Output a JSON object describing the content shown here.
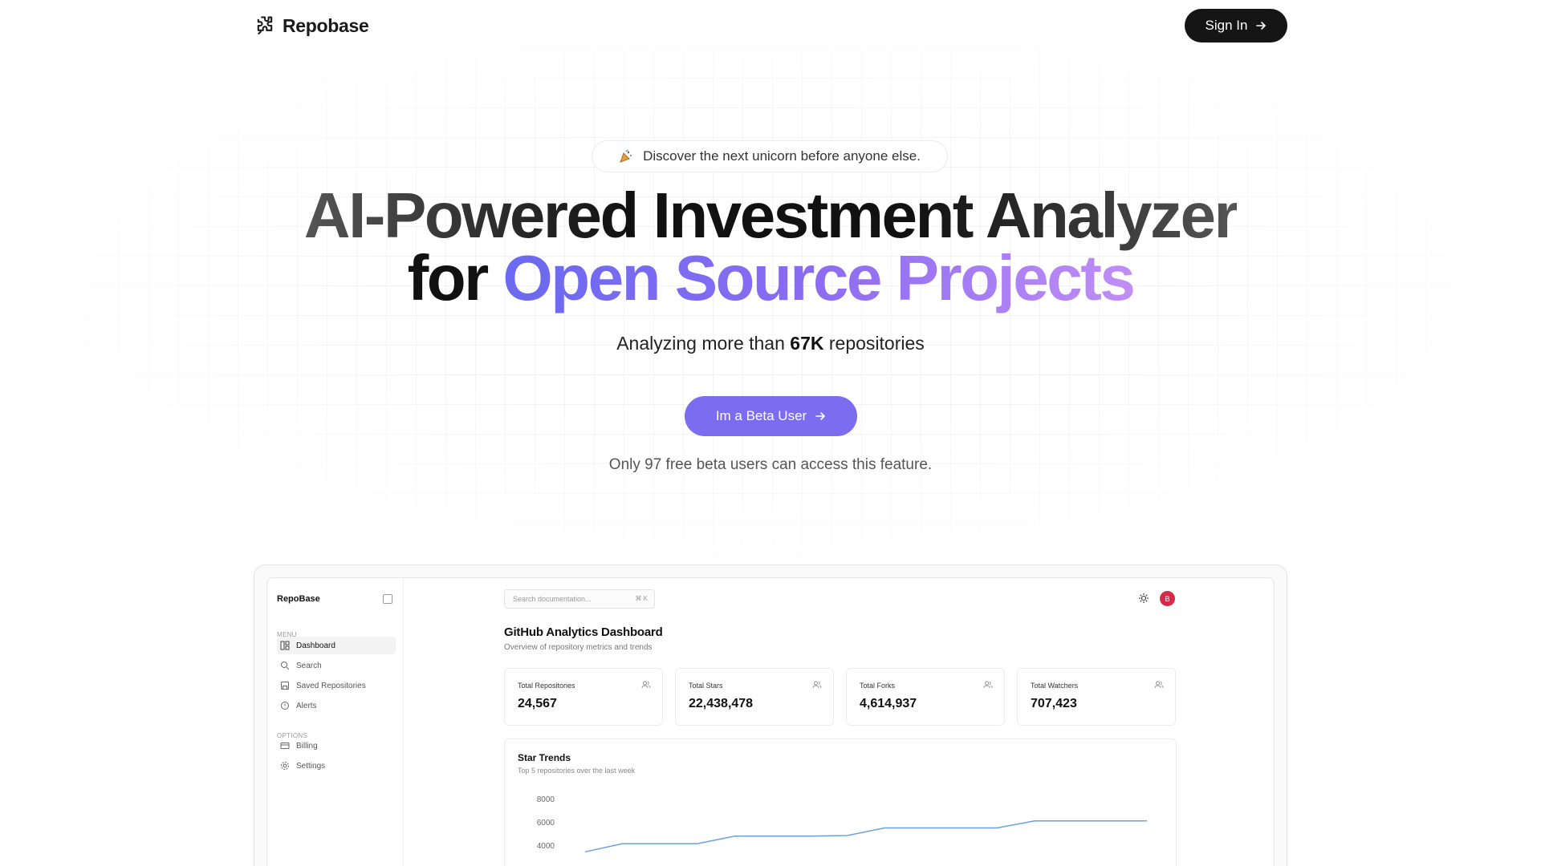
{
  "header": {
    "brand": "Repobase",
    "sign_in": "Sign In"
  },
  "hero": {
    "pill_text": "Discover the next unicorn before anyone else.",
    "headline_line1": "AI-Powered Investment Analyzer",
    "headline_for": "for",
    "headline_gradient": "Open Source Projects",
    "sub_prefix": "Analyzing more than",
    "sub_count": "67K",
    "sub_suffix": "repositories",
    "cta": "Im a Beta User",
    "note": "Only 97 free beta users can access this feature."
  },
  "dashboard": {
    "brand": "RepoBase",
    "menu_label": "MENU",
    "menu": [
      {
        "label": "Dashboard",
        "icon": "dashboard-icon"
      },
      {
        "label": "Search",
        "icon": "search-icon"
      },
      {
        "label": "Saved Repositories",
        "icon": "save-icon"
      },
      {
        "label": "Alerts",
        "icon": "alert-icon"
      }
    ],
    "options_label": "OPTIONS",
    "options": [
      {
        "label": "Billing",
        "icon": "card-icon"
      },
      {
        "label": "Settings",
        "icon": "gear-icon"
      }
    ],
    "search_placeholder": "Search documentation...",
    "search_kbd": "⌘ K",
    "avatar_initial": "B",
    "title": "GitHub Analytics Dashboard",
    "subtitle": "Overview of repository metrics and trends",
    "stats": [
      {
        "label": "Total Repositories",
        "value": "24,567"
      },
      {
        "label": "Total Stars",
        "value": "22,438,478"
      },
      {
        "label": "Total Forks",
        "value": "4,614,937"
      },
      {
        "label": "Total Watchers",
        "value": "707,423"
      }
    ],
    "chart_title": "Star Trends",
    "chart_subtitle": "Top 5 repositories over the last week"
  },
  "colors": {
    "accent": "#7c6cf0",
    "gradient_start": "#6a6af0",
    "gradient_end": "#c08ef5",
    "avatar": "#d8294a",
    "line": "#6aa0e0"
  },
  "chart_data": {
    "type": "line",
    "title": "Star Trends",
    "yticks": [
      "8000",
      "6000",
      "4000"
    ],
    "ylim": [
      4000,
      8000
    ],
    "series": [
      {
        "values": [
          3500,
          4200,
          4200,
          4200,
          4850,
          4850,
          4850,
          4900,
          5550,
          5550,
          5550,
          5550,
          6150,
          6150,
          6150,
          6150
        ]
      }
    ]
  }
}
